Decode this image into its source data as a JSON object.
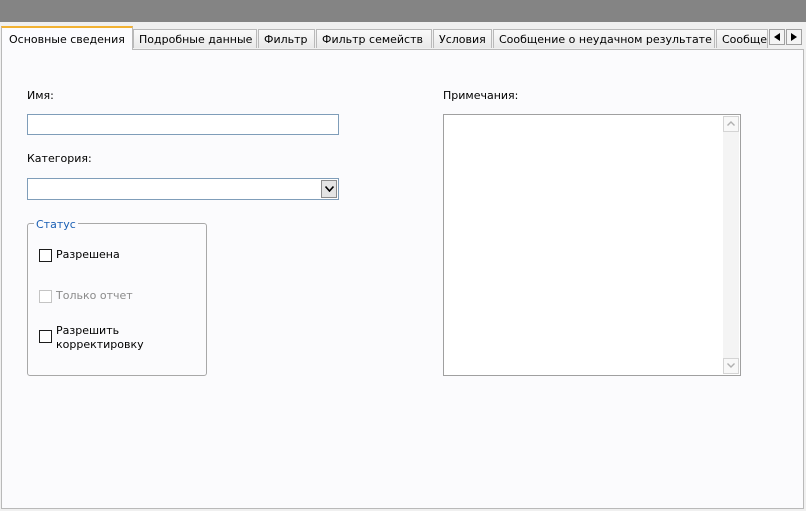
{
  "tabs": [
    {
      "label": "Основные сведения",
      "active": true
    },
    {
      "label": "Подробные данные",
      "active": false
    },
    {
      "label": "Фильтр",
      "active": false
    },
    {
      "label": "Фильтр семейств",
      "active": false
    },
    {
      "label": "Условия",
      "active": false
    },
    {
      "label": "Сообщение о неудачном результате",
      "active": false
    },
    {
      "label": "Сообще",
      "active": false
    }
  ],
  "form": {
    "name_label": "Имя:",
    "name_value": "",
    "category_label": "Категория:",
    "category_value": "",
    "notes_label": "Примечания:",
    "notes_value": ""
  },
  "status": {
    "legend": "Статус",
    "options": [
      {
        "label": "Разрешена",
        "checked": false,
        "enabled": true
      },
      {
        "label": "Только отчет",
        "checked": false,
        "enabled": false
      },
      {
        "label": "Разрешить корректировку",
        "checked": false,
        "enabled": true
      }
    ]
  },
  "icons": {
    "tab_scroll_left": "triangle-left-icon",
    "tab_scroll_right": "triangle-right-icon",
    "dropdown": "chevron-down-icon",
    "scroll_up": "chevron-up-icon",
    "scroll_down": "chevron-down-icon"
  },
  "colors": {
    "active_tab_accent": "#f2b233",
    "group_legend": "#1a5fb4",
    "panel_background": "#fbfbfd",
    "title_bar": "#848484"
  }
}
